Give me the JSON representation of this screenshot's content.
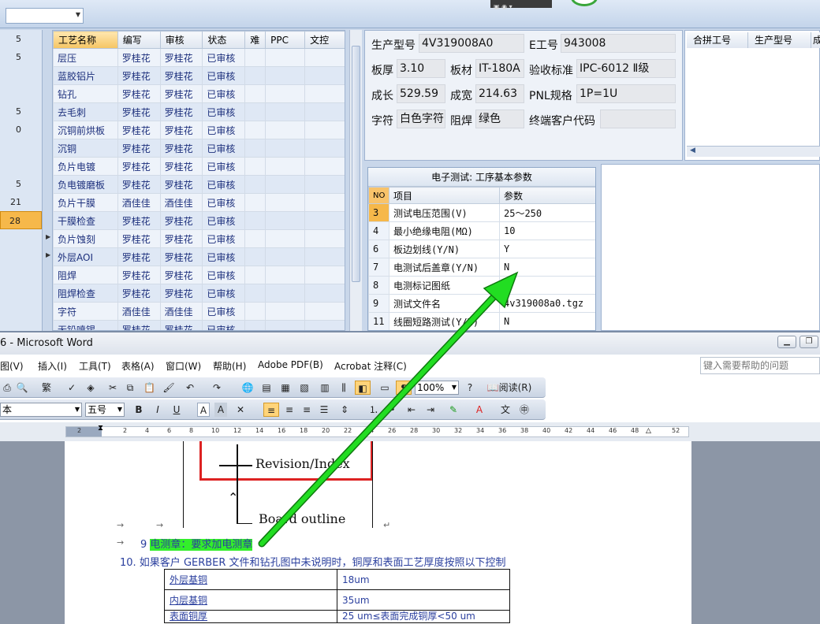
{
  "erp": {
    "left_list": [
      "5",
      "5",
      "",
      "",
      "5",
      "0",
      "",
      "",
      "5",
      "21",
      "28"
    ],
    "process_table": {
      "headers": [
        "工艺名称",
        "编写",
        "审核",
        "状态",
        "难",
        "PPC",
        "文控"
      ],
      "rows": [
        [
          "层压",
          "罗桂花",
          "罗桂花",
          "已审核"
        ],
        [
          "蓝胶铝片",
          "罗桂花",
          "罗桂花",
          "已审核"
        ],
        [
          "钻孔",
          "罗桂花",
          "罗桂花",
          "已审核"
        ],
        [
          "去毛刺",
          "罗桂花",
          "罗桂花",
          "已审核"
        ],
        [
          "沉铜前烘板",
          "罗桂花",
          "罗桂花",
          "已审核"
        ],
        [
          "沉铜",
          "罗桂花",
          "罗桂花",
          "已审核"
        ],
        [
          "负片电镀",
          "罗桂花",
          "罗桂花",
          "已审核"
        ],
        [
          "负电镀磨板",
          "罗桂花",
          "罗桂花",
          "已审核"
        ],
        [
          "负片干膜",
          "酒佳佳",
          "酒佳佳",
          "已审核"
        ],
        [
          "干膜检查",
          "罗桂花",
          "罗桂花",
          "已审核"
        ],
        [
          "负片蚀刻",
          "罗桂花",
          "罗桂花",
          "已审核"
        ],
        [
          "外层AOI",
          "罗桂花",
          "罗桂花",
          "已审核"
        ],
        [
          "阻焊",
          "罗桂花",
          "罗桂花",
          "已审核"
        ],
        [
          "阻焊检查",
          "罗桂花",
          "罗桂花",
          "已审核"
        ],
        [
          "字符",
          "酒佳佳",
          "酒佳佳",
          "已审核"
        ],
        [
          "无铅喷锡",
          "罗桂花",
          "罗桂花",
          "已审核"
        ]
      ]
    },
    "info": {
      "model_label": "生产型号",
      "model_value": "4V319008A0",
      "eno_label": "E工号",
      "eno_value": "943008",
      "thick_label": "板厚",
      "thick_value": "3.10",
      "material_label": "板材",
      "material_value": "IT-180A",
      "standard_label": "验收标准",
      "standard_value": "IPC-6012 Ⅱ级",
      "length_label": "成长",
      "length_value": "529.59",
      "width_label": "成宽",
      "width_value": "214.63",
      "pnl_label": "PNL规格",
      "pnl_value": "1P=1U",
      "char_label": "字符",
      "char_value": "白色字符",
      "mask_label": "阻焊",
      "mask_value": "绿色",
      "customer_label": "终端客户代码",
      "customer_value": ""
    },
    "merge_headers": [
      "合拼工号",
      "生产型号",
      "成"
    ],
    "param": {
      "title": "电子测试: 工序基本参数",
      "headers": [
        "NO",
        "项目",
        "参数"
      ],
      "rows": [
        [
          "3",
          "测试电压范围(V)",
          "25～250"
        ],
        [
          "4",
          "最小绝缘电阻(MΩ)",
          "10"
        ],
        [
          "6",
          "板边划线(Y/N)",
          "Y"
        ],
        [
          "7",
          "电测试后盖章(Y/N)",
          "N"
        ],
        [
          "8",
          "电测标记图纸",
          ""
        ],
        [
          "9",
          "测试文件名",
          "4v319008a0.tgz"
        ],
        [
          "11",
          "线圈短路测试(Y/N)",
          "N"
        ]
      ]
    }
  },
  "word": {
    "title": "6 - Microsoft Word",
    "menu": [
      "图(V)",
      "插入(I)",
      "工具(T)",
      "表格(A)",
      "窗口(W)",
      "帮助(H)",
      "Adobe PDF(B)",
      "Acrobat 注释(C)"
    ],
    "help_placeholder": "键入需要帮助的问题",
    "zoom": "100%",
    "read_label": "阅读(R)",
    "style_value": "本",
    "size_value": "五号",
    "ruler_numbers": [
      "2",
      "2",
      "4",
      "6",
      "8",
      "10",
      "12",
      "14",
      "16",
      "18",
      "20",
      "22",
      "24",
      "26",
      "28",
      "30",
      "32",
      "34",
      "36",
      "38",
      "40",
      "42",
      "44",
      "46",
      "48",
      "52"
    ],
    "figure": {
      "revision_label": "Revision/Index",
      "board_label": "Board outline"
    },
    "item9_number": "9",
    "item9_text": "电测章：要求加电测章",
    "item10_text": "10.  如果客户 GERBER 文件和钻孔图中未说明时，铜厚和表面工艺厚度按照以下控制",
    "copper_table": [
      [
        "外层基铜",
        "18um"
      ],
      [
        "内层基铜",
        "35um"
      ],
      [
        "表面铜厚",
        "25 um≤表面完成铜厚<50 um"
      ]
    ]
  },
  "annotation": {
    "arrow_color": "#22dd22"
  }
}
